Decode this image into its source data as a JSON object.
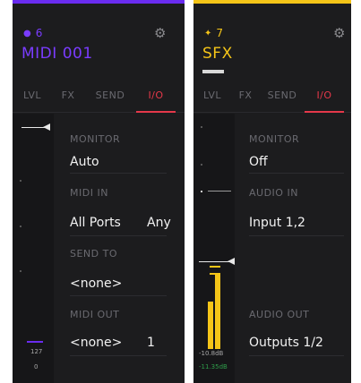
{
  "tracks": [
    {
      "number": "6",
      "name": "MIDI 001",
      "accent": "#6a2cf0",
      "name_color": "#7a3cff",
      "icon": "midi-icon",
      "tabs": [
        "LVL",
        "FX",
        "SEND",
        "I/O"
      ],
      "active_tab": "I/O",
      "meter_labels": [
        "127",
        "0"
      ],
      "sections": {
        "monitor": {
          "label": "MONITOR",
          "value": "Auto"
        },
        "midi_in": {
          "label": "MIDI IN",
          "value": "All Ports",
          "channel": "Any"
        },
        "send_to": {
          "label": "SEND TO",
          "value": "<none>"
        },
        "midi_out": {
          "label": "MIDI OUT",
          "value": "<none>",
          "channel": "1"
        }
      }
    },
    {
      "number": "7",
      "name": "SFX",
      "accent": "#f5c518",
      "name_color": "#f5c518",
      "icon": "audio-icon",
      "tabs": [
        "LVL",
        "FX",
        "SEND",
        "I/O"
      ],
      "active_tab": "I/O",
      "meter_labels": [
        "-10.8dB",
        "-11.35dB"
      ],
      "meter_label_colors": [
        "#d8d8d8",
        "#2e9e4a"
      ],
      "sections": {
        "monitor": {
          "label": "MONITOR",
          "value": "Off"
        },
        "audio_in": {
          "label": "AUDIO IN",
          "value": "Input 1,2"
        },
        "audio_out": {
          "label": "AUDIO OUT",
          "value": "Outputs 1/2"
        }
      }
    }
  ],
  "gear_icon": "gear-icon"
}
